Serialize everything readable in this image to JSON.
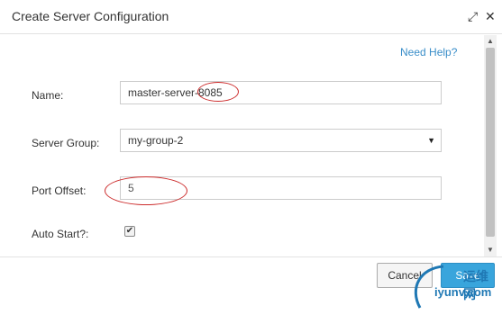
{
  "dialog": {
    "title": "Create Server Configuration",
    "maximize_glyph": "⤢",
    "close_glyph": "✕"
  },
  "help_link": "Need Help?",
  "form": {
    "name_label": "Name:",
    "name_value": "master-server-8085",
    "group_label": "Server Group:",
    "group_value": "my-group-2",
    "group_arrow": "▼",
    "offset_label": "Port Offset:",
    "offset_value": "5",
    "autostart_label": "Auto Start?:",
    "autostart_checked": true,
    "check_glyph": "✔"
  },
  "scrollbar": {
    "up_glyph": "▲",
    "down_glyph": "▼"
  },
  "buttons": {
    "cancel": "Cancel",
    "save": "Save"
  },
  "watermark": {
    "text": "iyunv.com",
    "cn_text": "运维网"
  },
  "colors": {
    "link": "#3a8ec9",
    "primary": "#39a5dc",
    "annotation": "#cc2b2b"
  }
}
